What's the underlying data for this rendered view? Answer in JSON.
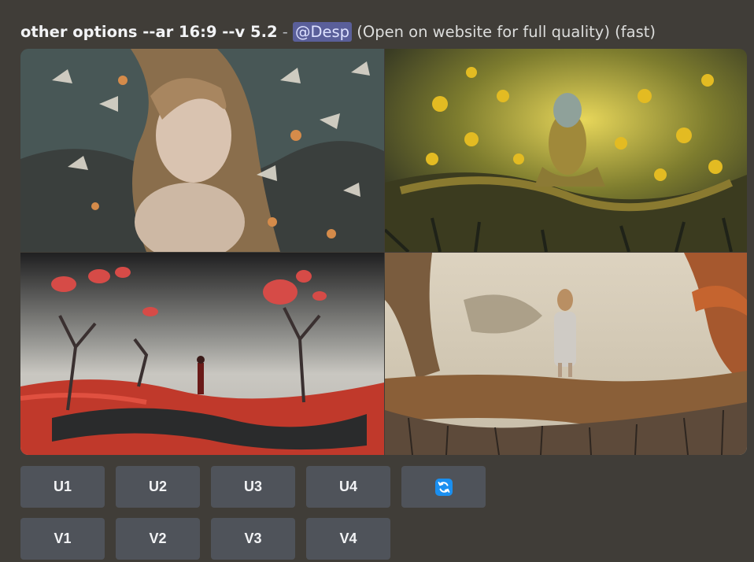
{
  "header": {
    "prompt": "other options --ar 16:9 --v 5.2",
    "separator": " - ",
    "mention": "@Desp",
    "suffix": " (Open on website for full quality) (fast)"
  },
  "grid": {
    "images": [
      {
        "name": "girl-with-butterflies"
      },
      {
        "name": "golden-forest-spirit"
      },
      {
        "name": "red-mushroom-landscape"
      },
      {
        "name": "girl-on-root-island"
      }
    ]
  },
  "buttons": {
    "upscale": [
      "U1",
      "U2",
      "U3",
      "U4"
    ],
    "variation": [
      "V1",
      "V2",
      "V3",
      "V4"
    ],
    "reroll_icon": "refresh-icon"
  },
  "colors": {
    "background": "#403d38",
    "button": "#4f535a",
    "mention_bg": "#5a5f9a",
    "reroll_icon": "#1a8ff0"
  }
}
